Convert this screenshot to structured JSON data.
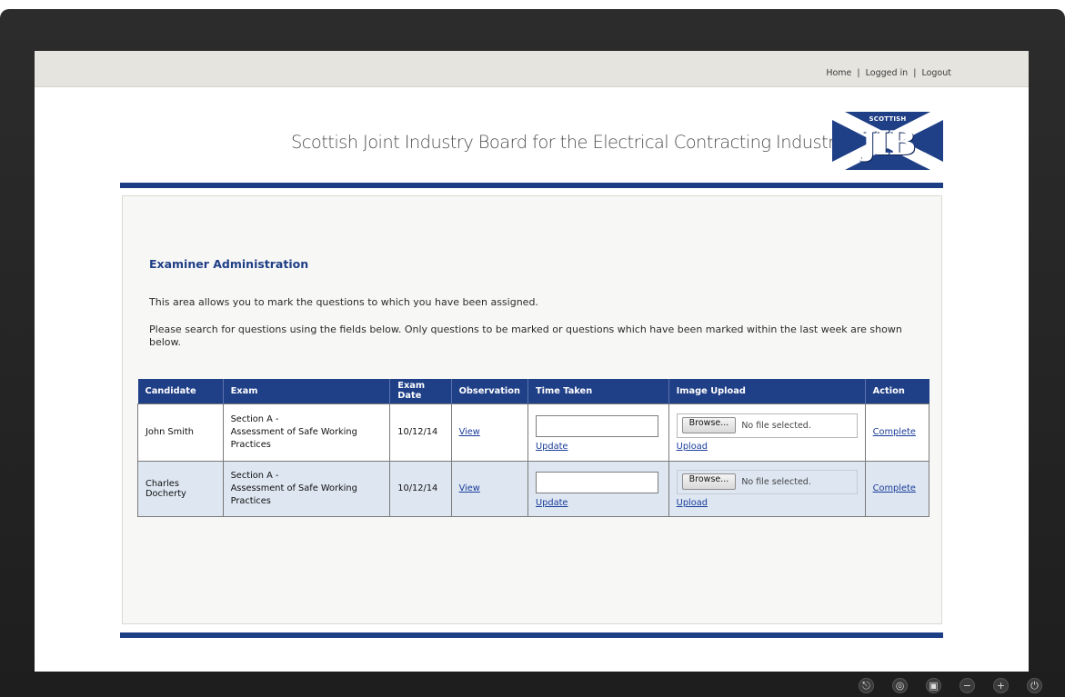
{
  "nav": {
    "home": "Home",
    "logged_in": "Logged in",
    "logout": "Logout",
    "separator": "|"
  },
  "site": {
    "title": "Scottish Joint Industry Board for the Electrical Contracting Industry",
    "logo_small": "SCOTTISH",
    "logo_big": "JIB"
  },
  "page": {
    "heading": "Examiner Administration",
    "intro": "This area allows you to mark the questions to which you have been assigned.",
    "instructions": "Please search for questions using the fields below. Only questions to be marked or questions which have been marked within the last week are shown below."
  },
  "table": {
    "headers": [
      "Candidate",
      "Exam",
      "Exam Date",
      "Observation",
      "Time Taken",
      "Image Upload",
      "Action"
    ],
    "rows": [
      {
        "candidate": "John Smith",
        "exam_line1": "Section A -",
        "exam_line2": "Assessment of Safe Working Practices",
        "exam_date": "10/12/14",
        "observation": "View",
        "time_value": "",
        "update": "Update",
        "browse": "Browse...",
        "file_status": "No file selected.",
        "upload": "Upload",
        "action": "Complete"
      },
      {
        "candidate": "Charles Docherty",
        "exam_line1": "Section A -",
        "exam_line2": "Assessment of Safe Working Practices",
        "exam_date": "10/12/14",
        "observation": "View",
        "time_value": "",
        "update": "Update",
        "browse": "Browse...",
        "file_status": "No file selected.",
        "upload": "Upload",
        "action": "Complete"
      }
    ]
  },
  "monitor_controls": [
    "input-icon",
    "menu-icon",
    "display-icon",
    "minus-icon",
    "plus-icon",
    "power-icon"
  ],
  "colors": {
    "brand_blue": "#1f3f86",
    "row_alt": "#dde6f1",
    "link": "#1a3c9a"
  }
}
